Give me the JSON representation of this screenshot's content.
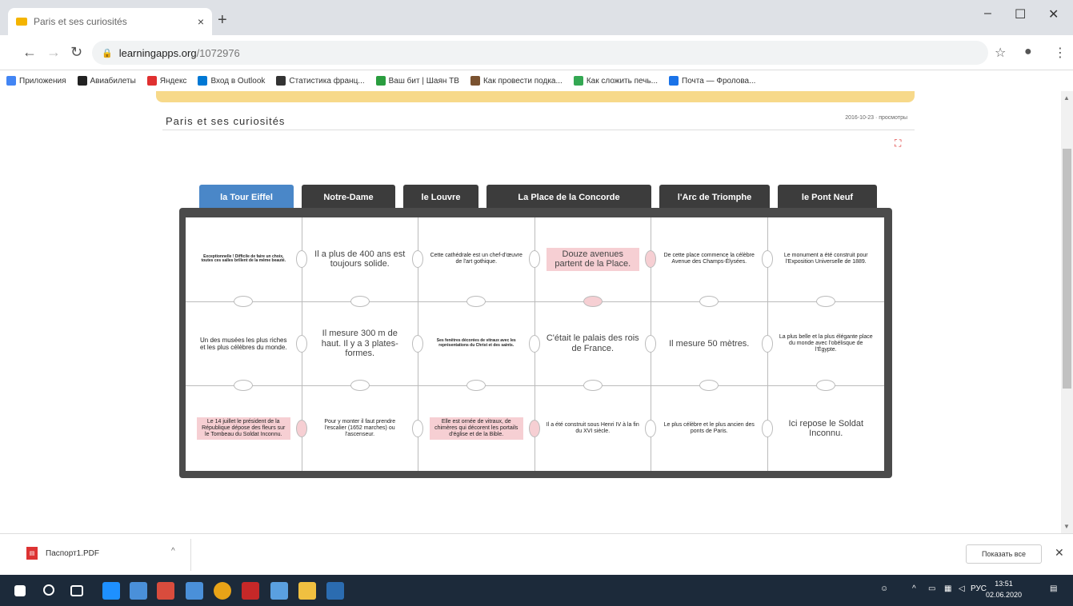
{
  "browser": {
    "tab_title": "Paris et ses curiosités",
    "tab_close": "×",
    "new_tab": "+",
    "url_host": "learningapps.org",
    "url_path": "/1072976",
    "window_controls": [
      "–",
      "☐",
      "✕"
    ]
  },
  "bookmarks": [
    {
      "label": "Приложения",
      "color": "#4285f4"
    },
    {
      "label": "Авиабилеты",
      "color": "#222222"
    },
    {
      "label": "Яндекс",
      "color": "#e03030"
    },
    {
      "label": "Вход в Outlook",
      "color": "#0078d4"
    },
    {
      "label": "Статистика франц...",
      "color": "#333333"
    },
    {
      "label": "Ваш бит | Шаян ТВ",
      "color": "#2a9d3f"
    },
    {
      "label": "Как провести подка...",
      "color": "#7a5230"
    },
    {
      "label": "Как сложить печь...",
      "color": "#34a853"
    },
    {
      "label": "Почта — Фролова...",
      "color": "#1a73e8"
    }
  ],
  "app": {
    "title": "Paris et ses curiosités",
    "meta": "2016-10-23 · просмотры",
    "fullscreen_icon": "⛶"
  },
  "puzzle": {
    "tabs": [
      {
        "label": "la Tour Eiffel",
        "active": true
      },
      {
        "label": "Notre-Dame",
        "active": false
      },
      {
        "label": "le Louvre",
        "active": false
      },
      {
        "label": "La Place de la Concorde",
        "active": false
      },
      {
        "label": "l'Arc de Triomphe",
        "active": false
      },
      {
        "label": "le Pont Neuf",
        "active": false
      }
    ],
    "cells": [
      {
        "text": "Exceptionnelle ! Difficile de faire un choix, toutes ces salles brillent de la même beauté.",
        "size": "tiny",
        "highlight": false
      },
      {
        "text": "Il a plus de 400 ans est toujours solide.",
        "size": "lg",
        "highlight": false
      },
      {
        "text": "Cette cathédrale est un chef-d'œuvre de l'art gothique.",
        "size": "sm",
        "highlight": false
      },
      {
        "text": "Douze avenues partent de la Place.",
        "size": "lg",
        "highlight": true
      },
      {
        "text": "De cette place commence la célèbre Avenue des Champs-Élysées.",
        "size": "sm",
        "highlight": false
      },
      {
        "text": "Le monument a été construit pour l'Exposition Universelle de 1889.",
        "size": "sm",
        "highlight": false
      },
      {
        "text": "Un des musées les plus riches et les plus célèbres du monde.",
        "size": "md",
        "highlight": false
      },
      {
        "text": "Il mesure 300 m de haut. Il y a 3 plates-formes.",
        "size": "lg",
        "highlight": false
      },
      {
        "text": "Ses fenêtres décorées de vitraux avec les représentations du Christ et des saints.",
        "size": "tiny",
        "highlight": false
      },
      {
        "text": "C'était le palais des rois de France.",
        "size": "lg",
        "highlight": false
      },
      {
        "text": "Il mesure 50 mètres.",
        "size": "lg",
        "highlight": false
      },
      {
        "text": "La plus belle et la plus élégante place du monde avec l'obélisque de l'Égypte.",
        "size": "sm",
        "highlight": false
      },
      {
        "text": "Le 14 juillet le président de la République dépose des fleurs sur le Tombeau du Soldat Inconnu.",
        "size": "sm",
        "highlight": true
      },
      {
        "text": "Pour y monter il faut prendre l'escalier (1652 marches) ou l'ascenseur.",
        "size": "sm",
        "highlight": false
      },
      {
        "text": "Elle est ornée de vitraux, de chimères qui décorent les portails d'église et de la Bible.",
        "size": "sm",
        "highlight": true
      },
      {
        "text": "Il a été construit sous Henri IV à la fin du XVI siècle.",
        "size": "sm",
        "highlight": false
      },
      {
        "text": "Le plus célèbre et le plus ancien des ponts de Paris.",
        "size": "sm",
        "highlight": false
      },
      {
        "text": "Ici repose le Soldat Inconnu.",
        "size": "lg",
        "highlight": false
      }
    ]
  },
  "downloads": {
    "file": "Паспорт1.PDF",
    "show_all": "Показать все",
    "close": "✕"
  },
  "taskbar": {
    "lang": "РУС",
    "time": "13:51",
    "date": "02.06.2020"
  }
}
